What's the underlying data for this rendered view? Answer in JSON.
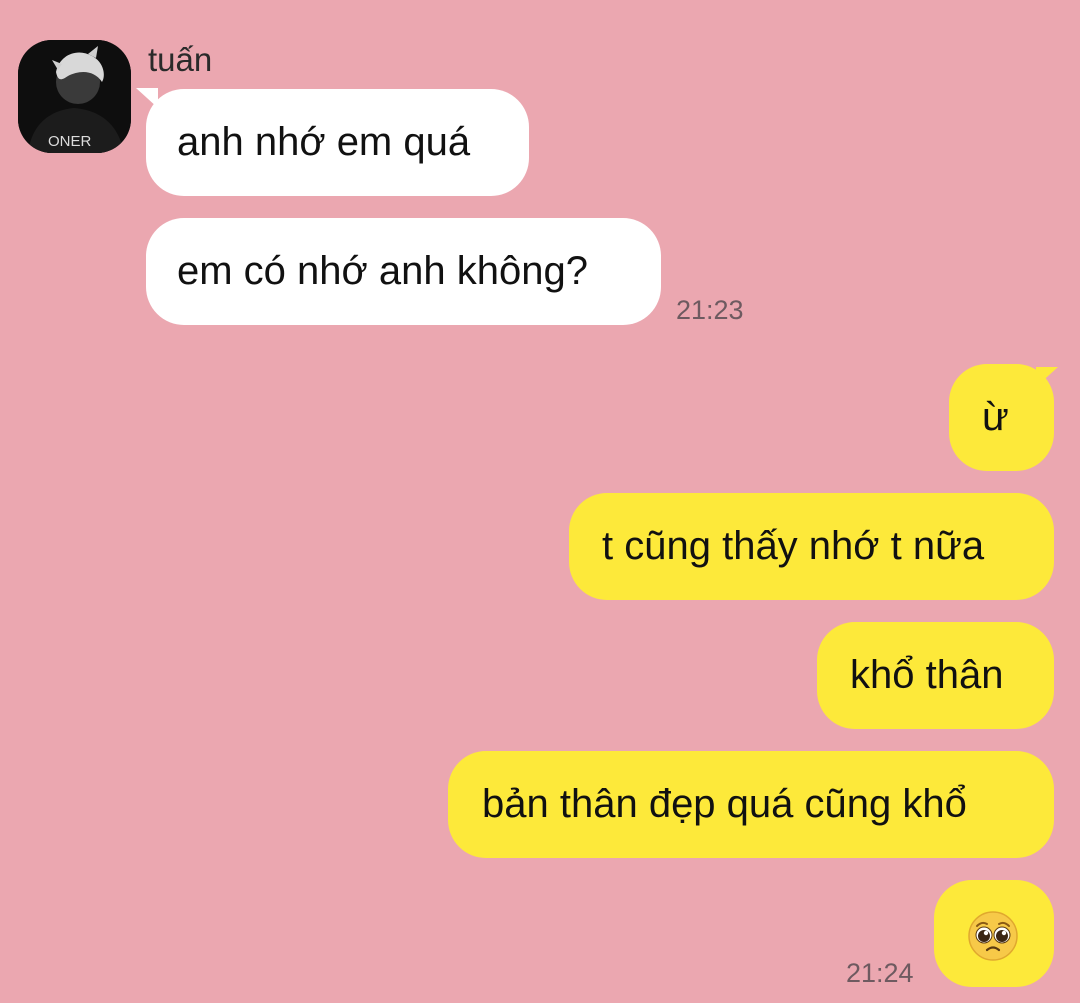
{
  "contact": {
    "name": "tuấn",
    "avatar_text": "ONER"
  },
  "incoming": {
    "messages": [
      "anh nhớ em quá",
      "em có nhớ anh không?"
    ],
    "time": "21:23"
  },
  "outgoing": {
    "messages": [
      "ừ",
      "t cũng thấy nhớ t nữa",
      "khổ thân",
      "bản thân đẹp quá cũng khổ"
    ],
    "emoji": "pleading-face-emoji",
    "time": "21:24"
  },
  "colors": {
    "background": "#eba7b0",
    "incoming_bubble": "#ffffff",
    "outgoing_bubble": "#fde93a"
  }
}
